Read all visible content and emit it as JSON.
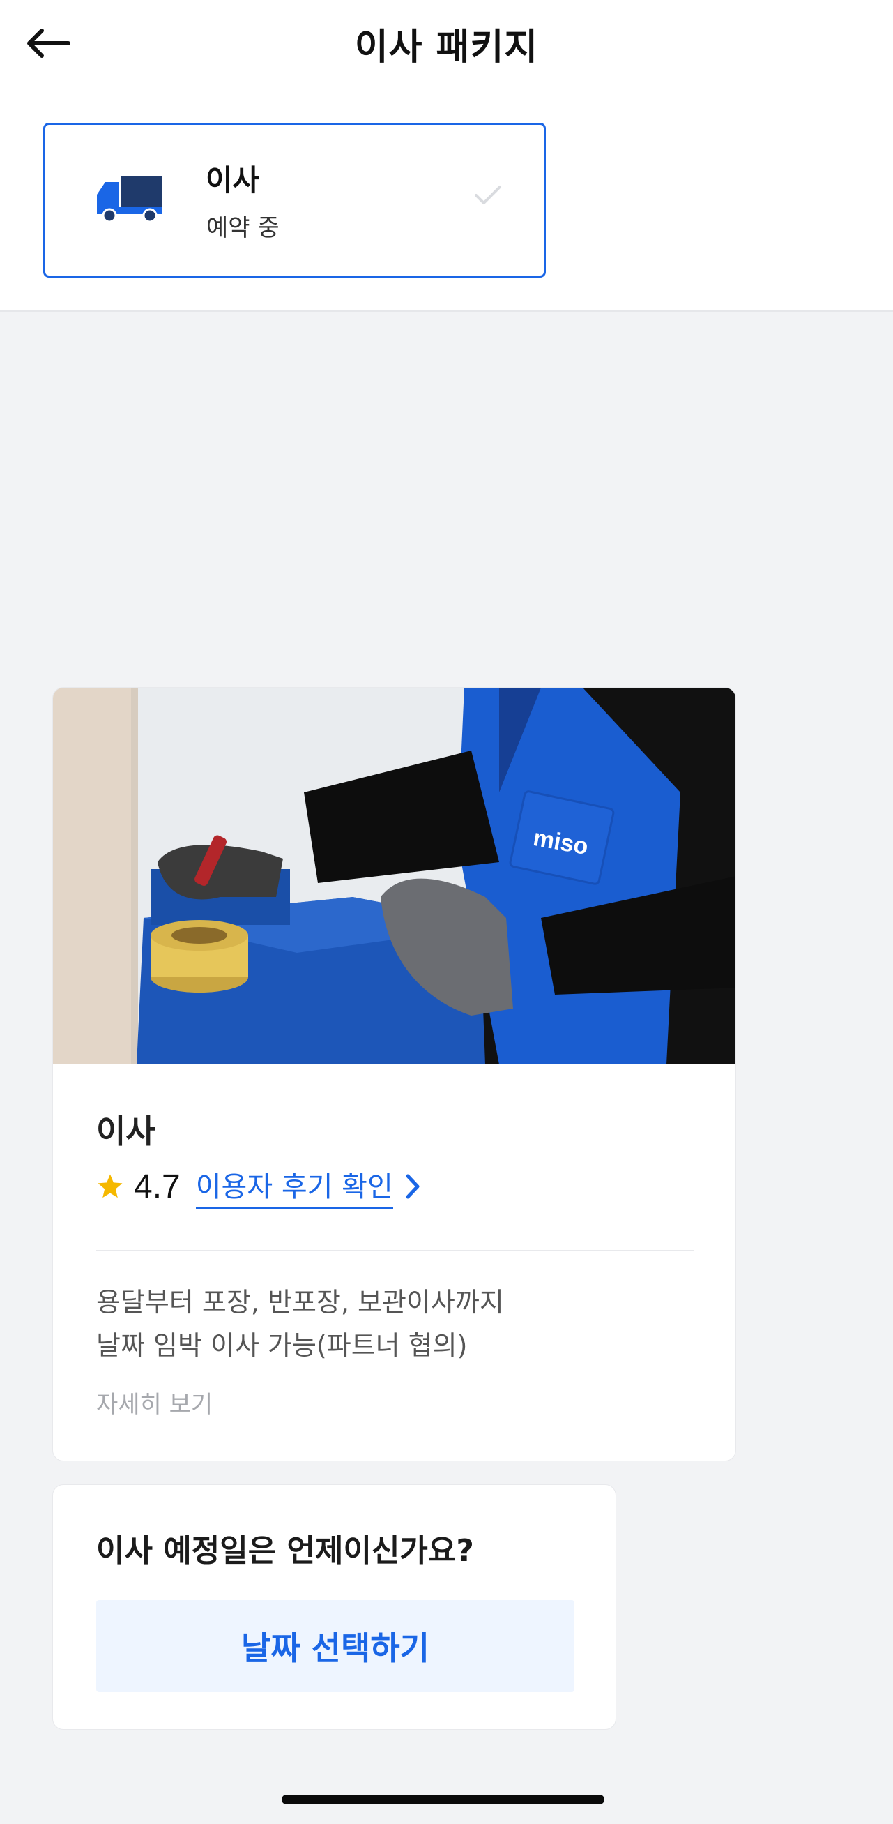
{
  "header": {
    "title": "이사 패키지",
    "back_icon": "arrow-left-icon"
  },
  "service": {
    "name": "이사",
    "status": "예약 중",
    "icon": "truck-icon",
    "selected_icon": "check-icon"
  },
  "package": {
    "title": "이사",
    "rating": "4.7",
    "reviews_link": "이용자 후기 확인",
    "description_line1": "용달부터 포장, 반포장, 보관이사까지",
    "description_line2": "날짜 임박 이사 가능(파트너 협의)",
    "detail_link": "자세히 보기",
    "photo_badge": "miso"
  },
  "date": {
    "question": "이사 예정일은 언제이신가요?",
    "button_label": "날짜 선택하기"
  },
  "colors": {
    "accent": "#1a66e6",
    "star": "#f5b800",
    "background": "#f2f3f5"
  }
}
